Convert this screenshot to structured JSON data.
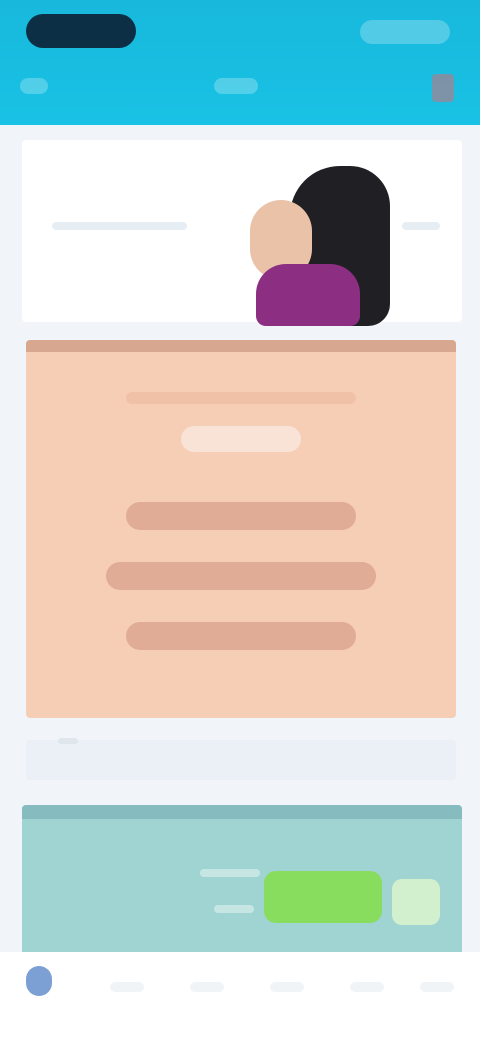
{
  "header": {
    "logo": "logo-pill",
    "menu_icon": "menu-icon",
    "colors": {
      "bar": "#19c2e4",
      "logo": "#0d2f45"
    }
  },
  "banner": {
    "image": "person-photo",
    "colors": {
      "background": "#ffffff"
    }
  },
  "promo": {
    "colors": {
      "background": "#f6cdb5",
      "text_bars": "#e0ac96"
    }
  },
  "feature_card": {
    "button": "green-action-button",
    "colors": {
      "background": "#9fd4d2",
      "button": "#88dd5e"
    }
  },
  "bottom_nav": {
    "home_icon": "home-icon",
    "colors": {
      "active": "#5b88c9"
    }
  }
}
